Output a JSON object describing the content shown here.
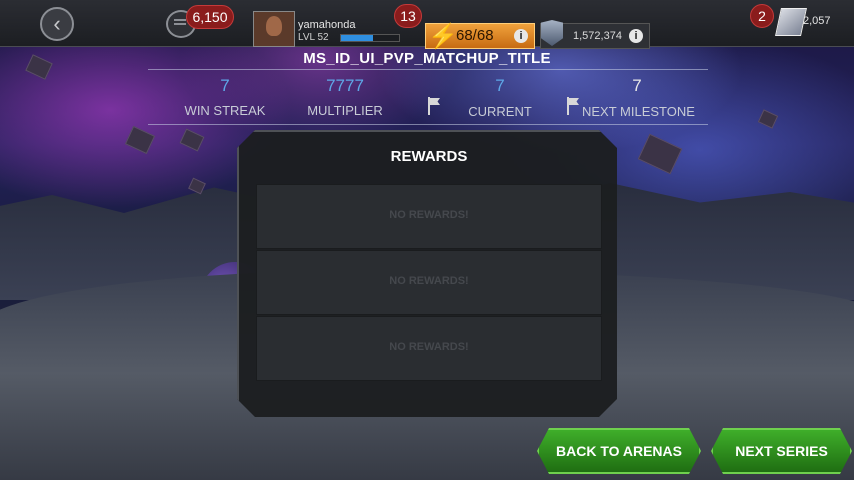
{
  "topbar": {
    "back_icon": "chevron-left-icon",
    "chat_icon": "chat-bubble-icon",
    "chat_badge": "6,150",
    "user": {
      "name": "yamahonda",
      "level": "LVL 52",
      "xp_fraction": 0.55,
      "alert_badge": "13"
    },
    "energy": {
      "text": "68/68",
      "icon": "lightning-bolt-icon"
    },
    "gold": {
      "text": "1,572,374",
      "icon": "gold-shield-icon"
    },
    "crystals": {
      "badge": "2",
      "count": "2,057",
      "icon": "crystal-icon"
    }
  },
  "header": {
    "title": "MS_ID_UI_PVP_MATCHUP_TITLE",
    "stats": [
      {
        "value": "7",
        "label": "WIN STREAK"
      },
      {
        "value": "7777",
        "label": "MULTIPLIER"
      },
      {
        "value": "7",
        "label": "CURRENT"
      },
      {
        "value": "7",
        "label": "NEXT MILESTONE"
      }
    ]
  },
  "rewards": {
    "title": "REWARDS",
    "rows": [
      {
        "text": "NO REWARDS!"
      },
      {
        "text": "NO REWARDS!"
      },
      {
        "text": "NO REWARDS!"
      }
    ]
  },
  "buttons": {
    "back_to_arenas": "BACK TO ARENAS",
    "next_series": "NEXT SERIES"
  },
  "colors": {
    "accent_blue": "#5ea8e8",
    "energy_orange": "#e08a20",
    "button_green": "#2f8e1e",
    "badge_red": "#8a1c1c"
  }
}
